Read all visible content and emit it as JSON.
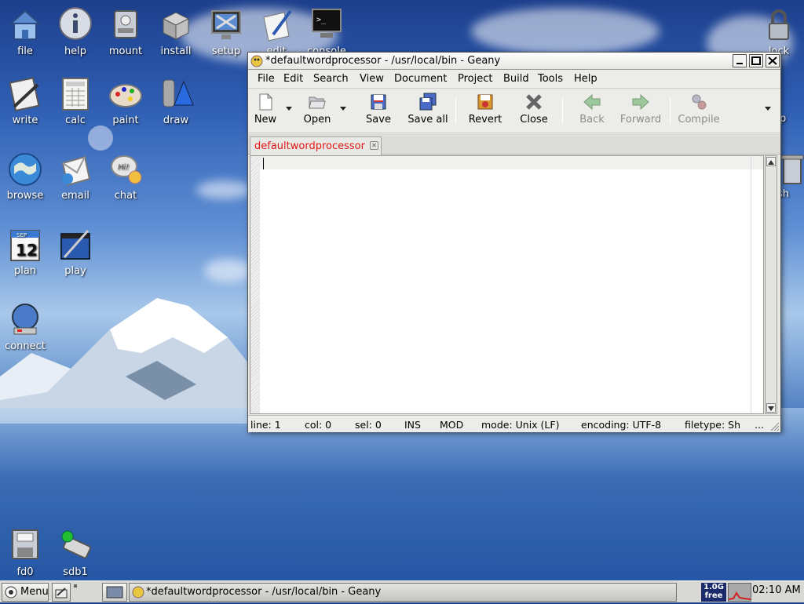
{
  "desktop": {
    "icons": [
      {
        "label": "file",
        "icon": "home-folder-icon"
      },
      {
        "label": "help",
        "icon": "info-icon"
      },
      {
        "label": "mount",
        "icon": "drive-icon"
      },
      {
        "label": "install",
        "icon": "package-icon"
      },
      {
        "label": "setup",
        "icon": "tools-monitor-icon"
      },
      {
        "label": "edit",
        "icon": "pen-paper-icon"
      },
      {
        "label": "console",
        "icon": "terminal-icon"
      },
      {
        "label": "lock",
        "icon": "padlock-icon"
      },
      {
        "label": "write",
        "icon": "writer-icon"
      },
      {
        "label": "calc",
        "icon": "spreadsheet-icon"
      },
      {
        "label": "paint",
        "icon": "palette-icon"
      },
      {
        "label": "draw",
        "icon": "shapes-icon"
      },
      {
        "label": "browse",
        "icon": "globe-icon"
      },
      {
        "label": "email",
        "icon": "envelope-icon"
      },
      {
        "label": "chat",
        "icon": "speech-bubble-icon"
      },
      {
        "label": "plan",
        "icon": "calendar-icon"
      },
      {
        "label": "play",
        "icon": "media-icon"
      },
      {
        "label": "connect",
        "icon": "network-globe-icon"
      },
      {
        "label": "fd0",
        "icon": "floppy-icon"
      },
      {
        "label": "sdb1",
        "icon": "usb-drive-icon"
      },
      {
        "label": "p",
        "icon": "partial-icon"
      },
      {
        "label": "sh",
        "icon": "trash-icon"
      }
    ],
    "calendar_day": "12",
    "calendar_month": "SEP"
  },
  "window": {
    "title": "*defaultwordprocessor - /usr/local/bin - Geany",
    "menu": [
      "File",
      "Edit",
      "Search",
      "View",
      "Document",
      "Project",
      "Build",
      "Tools",
      "Help"
    ],
    "toolbar": {
      "new": "New",
      "open": "Open",
      "save": "Save",
      "save_all": "Save all",
      "revert": "Revert",
      "close": "Close",
      "back": "Back",
      "forward": "Forward",
      "compile": "Compile"
    },
    "tab_label": "defaultwordprocessor",
    "status": {
      "line": "line: 1",
      "col": "col: 0",
      "sel": "sel: 0",
      "ins": "INS",
      "mod": "MOD",
      "mode": "mode: Unix (LF)",
      "encoding": "encoding: UTF-8",
      "filetype": "filetype: Sh",
      "more": "..."
    }
  },
  "taskbar": {
    "menu_label": "Menu",
    "task_title": "*defaultwordprocessor - /usr/local/bin - Geany",
    "mem_top": "1.0G",
    "mem_bottom": "free",
    "clock": "02:10 AM"
  },
  "colors": {
    "tab_text": "#e01818",
    "desktop_sky": "#2f5fb4"
  }
}
